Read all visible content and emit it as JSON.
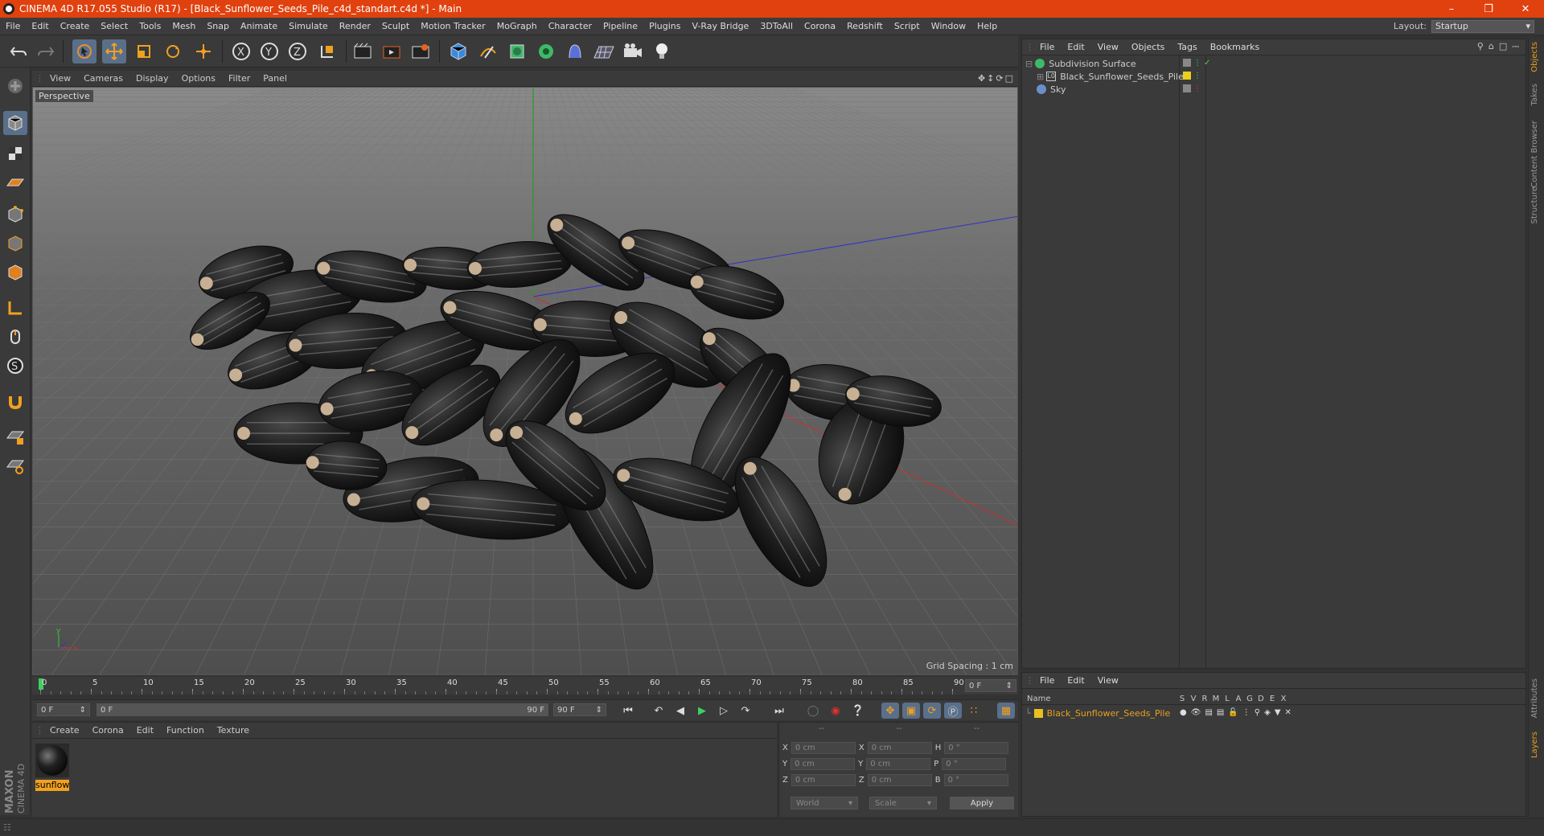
{
  "window": {
    "title": "CINEMA 4D R17.055 Studio (R17) - [Black_Sunflower_Seeds_Pile_c4d_standart.c4d *] - Main"
  },
  "menu": [
    "File",
    "Edit",
    "Create",
    "Select",
    "Tools",
    "Mesh",
    "Snap",
    "Animate",
    "Simulate",
    "Render",
    "Sculpt",
    "Motion Tracker",
    "MoGraph",
    "Character",
    "Pipeline",
    "Plugins",
    "V-Ray Bridge",
    "3DToAll",
    "Corona",
    "Redshift",
    "Script",
    "Window",
    "Help"
  ],
  "layout": {
    "label": "Layout:",
    "value": "Startup"
  },
  "viewport": {
    "menu": [
      "View",
      "Cameras",
      "Display",
      "Options",
      "Filter",
      "Panel"
    ],
    "label": "Perspective",
    "grid_spacing": "Grid Spacing : 1 cm"
  },
  "timeline": {
    "ticks": [
      "0",
      "5",
      "10",
      "15",
      "20",
      "25",
      "30",
      "35",
      "40",
      "45",
      "50",
      "55",
      "60",
      "65",
      "70",
      "75",
      "80",
      "85",
      "90"
    ],
    "current_frame": "0 F",
    "start_field": "0 F",
    "range_start": "0 F",
    "range_end": "90 F",
    "end_field": "90 F"
  },
  "material_manager": {
    "menu": [
      "Create",
      "Corona",
      "Edit",
      "Function",
      "Texture"
    ],
    "materials": [
      {
        "name": "sunflow"
      }
    ]
  },
  "coordinates": {
    "headers": [
      "--",
      "--",
      "--"
    ],
    "rows": [
      {
        "a": "X",
        "v1": "0 cm",
        "b": "X",
        "v2": "0 cm",
        "c": "H",
        "v3": "0 °"
      },
      {
        "a": "Y",
        "v1": "0 cm",
        "b": "Y",
        "v2": "0 cm",
        "c": "P",
        "v3": "0 °"
      },
      {
        "a": "Z",
        "v1": "0 cm",
        "b": "Z",
        "v2": "0 cm",
        "c": "B",
        "v3": "0 °"
      }
    ],
    "world": "World",
    "scale": "Scale",
    "apply": "Apply"
  },
  "object_manager": {
    "menu": [
      "File",
      "Edit",
      "View",
      "Objects",
      "Tags",
      "Bookmarks"
    ],
    "objects": [
      {
        "name": "Subdivision Surface",
        "color": "#3fb86a"
      },
      {
        "name": "Black_Sunflower_Seeds_Pile",
        "color": "#cccccc"
      },
      {
        "name": "Sky",
        "color": "#6a8fc8"
      }
    ]
  },
  "layer_manager": {
    "menu": [
      "File",
      "Edit",
      "View"
    ],
    "columns": {
      "name": "Name",
      "flags": [
        "S",
        "V",
        "R",
        "M",
        "L",
        "A",
        "G",
        "D",
        "E",
        "X"
      ]
    },
    "layers": [
      {
        "name": "Black_Sunflower_Seeds_Pile",
        "color": "#e8c020"
      }
    ]
  },
  "right_tabs": [
    "Objects",
    "Takes",
    "Content Browser",
    "Structure",
    "Attributes",
    "Layers"
  ],
  "brand": {
    "top": "MAXON",
    "bottom": "CINEMA 4D"
  },
  "colors": {
    "titlebar": "#e0410f",
    "accent": "#e8a020",
    "active_tool": "#5a6f8a"
  }
}
